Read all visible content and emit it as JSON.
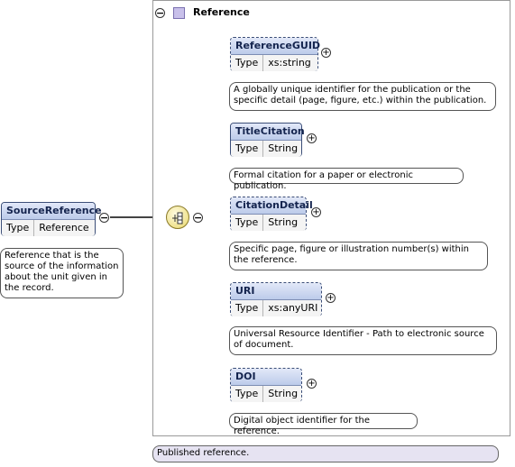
{
  "root": {
    "name": "SourceReference",
    "type_label": "Type",
    "type_value": "Reference",
    "doc": "Reference that is the source of the information about the unit given in the record."
  },
  "complex_type": {
    "title": "Reference",
    "doc": "Published reference."
  },
  "elements": [
    {
      "name": "ReferenceGUID",
      "type_label": "Type",
      "type_value": "xs:string",
      "doc": "A globally unique identifier for the publication or the specific detail (page, figure, etc.) within the publication."
    },
    {
      "name": "TitleCitation",
      "type_label": "Type",
      "type_value": "String",
      "doc": "Formal citation for a paper or electronic publication."
    },
    {
      "name": "CitationDetail",
      "type_label": "Type",
      "type_value": "String",
      "doc": "Specific page, figure or illustration number(s) within the reference."
    },
    {
      "name": "URI",
      "type_label": "Type",
      "type_value": "xs:anyURI",
      "doc": "Universal Resource Identifier - Path to electronic source of document."
    },
    {
      "name": "DOI",
      "type_label": "Type",
      "type_value": "String",
      "doc": "Digital object identifier for the reference."
    }
  ],
  "icons": {
    "collapse": "⊖",
    "expand": "+",
    "minus": "−"
  }
}
